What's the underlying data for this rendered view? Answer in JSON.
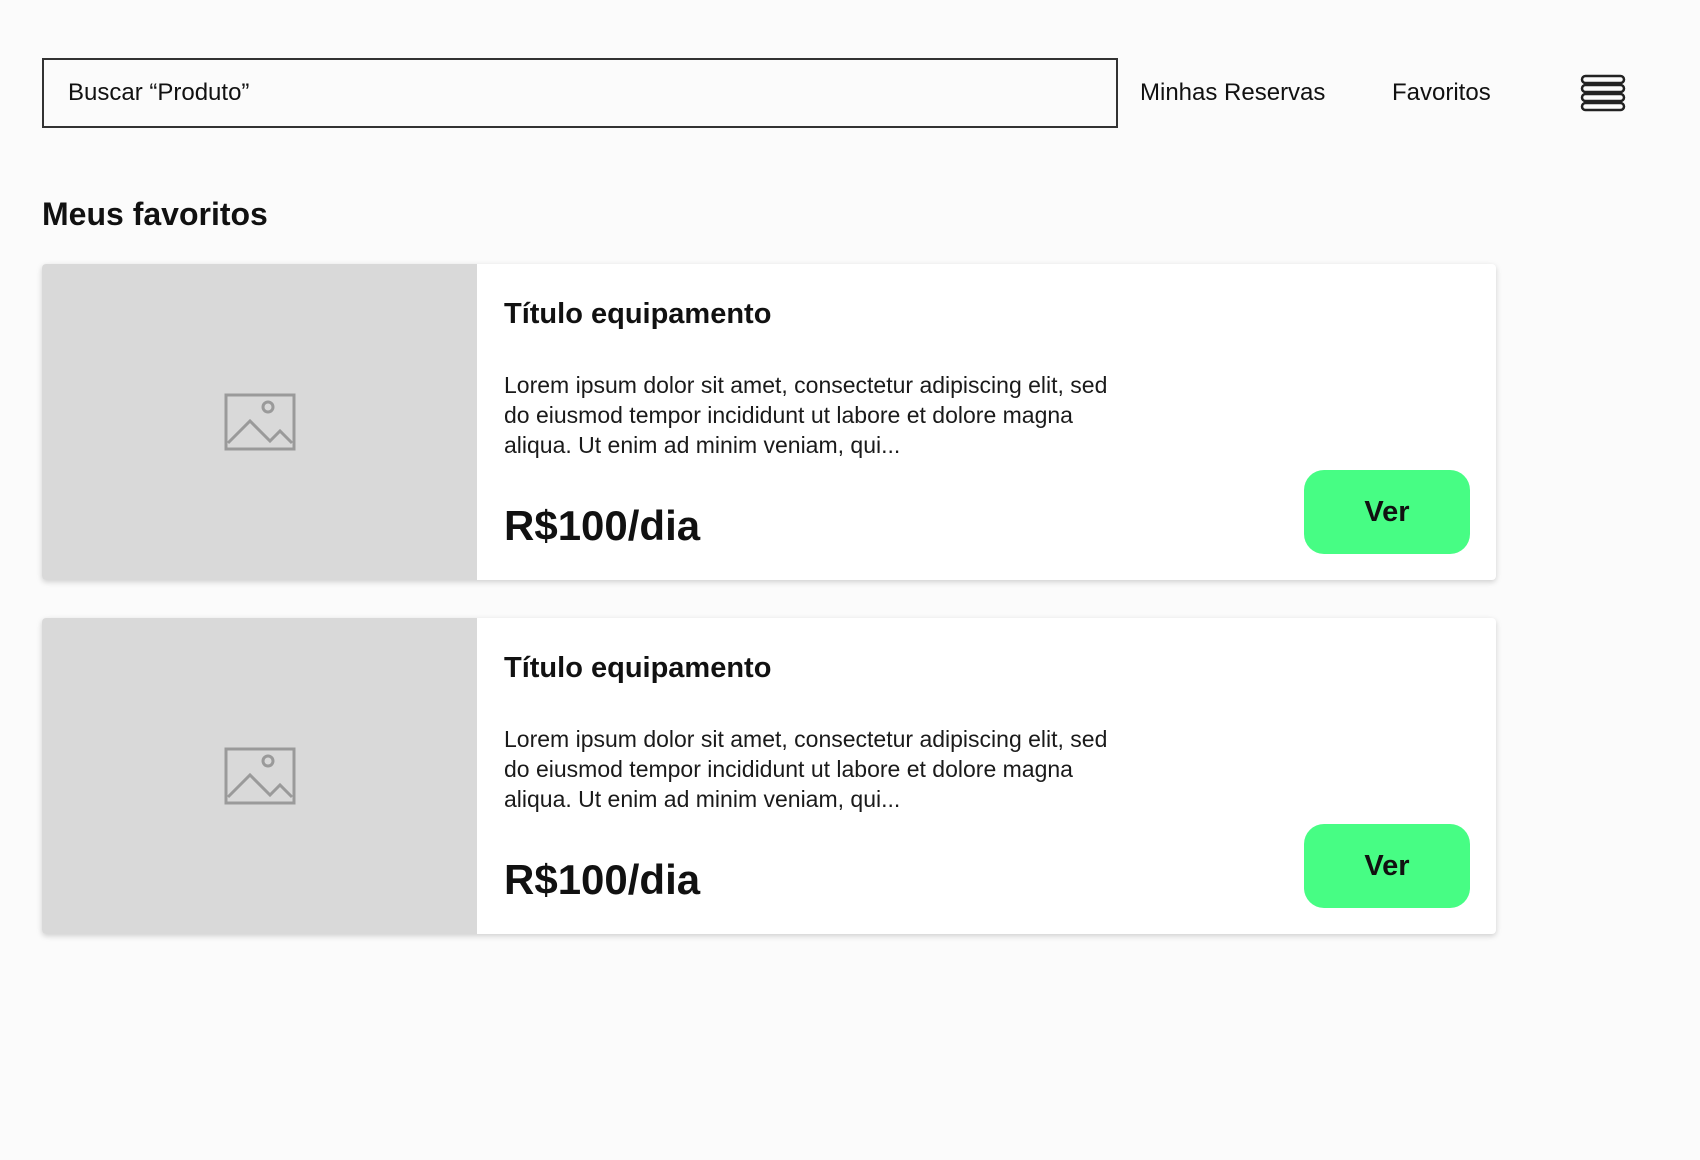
{
  "header": {
    "search_value": "Buscar “Produto”",
    "nav": {
      "reservas_label": "Minhas Reservas",
      "favoritos_label": "Favoritos"
    },
    "menu_icon": "hamburger-menu-icon"
  },
  "main": {
    "section_title": "Meus favoritos",
    "cards": [
      {
        "image_icon": "image-placeholder-icon",
        "title": "Título equipamento",
        "description": "Lorem ipsum dolor sit amet, consectetur adipiscing elit, sed do eiusmod tempor incididunt ut labore et dolore magna aliqua. Ut enim ad minim veniam, qui...",
        "price": "R$100/dia",
        "button_label": "Ver"
      },
      {
        "image_icon": "image-placeholder-icon",
        "title": "Título equipamento",
        "description": "Lorem ipsum dolor sit amet, consectetur adipiscing elit, sed do eiusmod tempor incididunt ut labore et dolore magna aliqua. Ut enim ad minim veniam, qui...",
        "price": "R$100/dia",
        "button_label": "Ver"
      }
    ]
  },
  "colors": {
    "page_background": "#fbfbfb",
    "image_placeholder": "#d9d9d9",
    "button_accent": "#47fd84",
    "text": "#111111"
  }
}
